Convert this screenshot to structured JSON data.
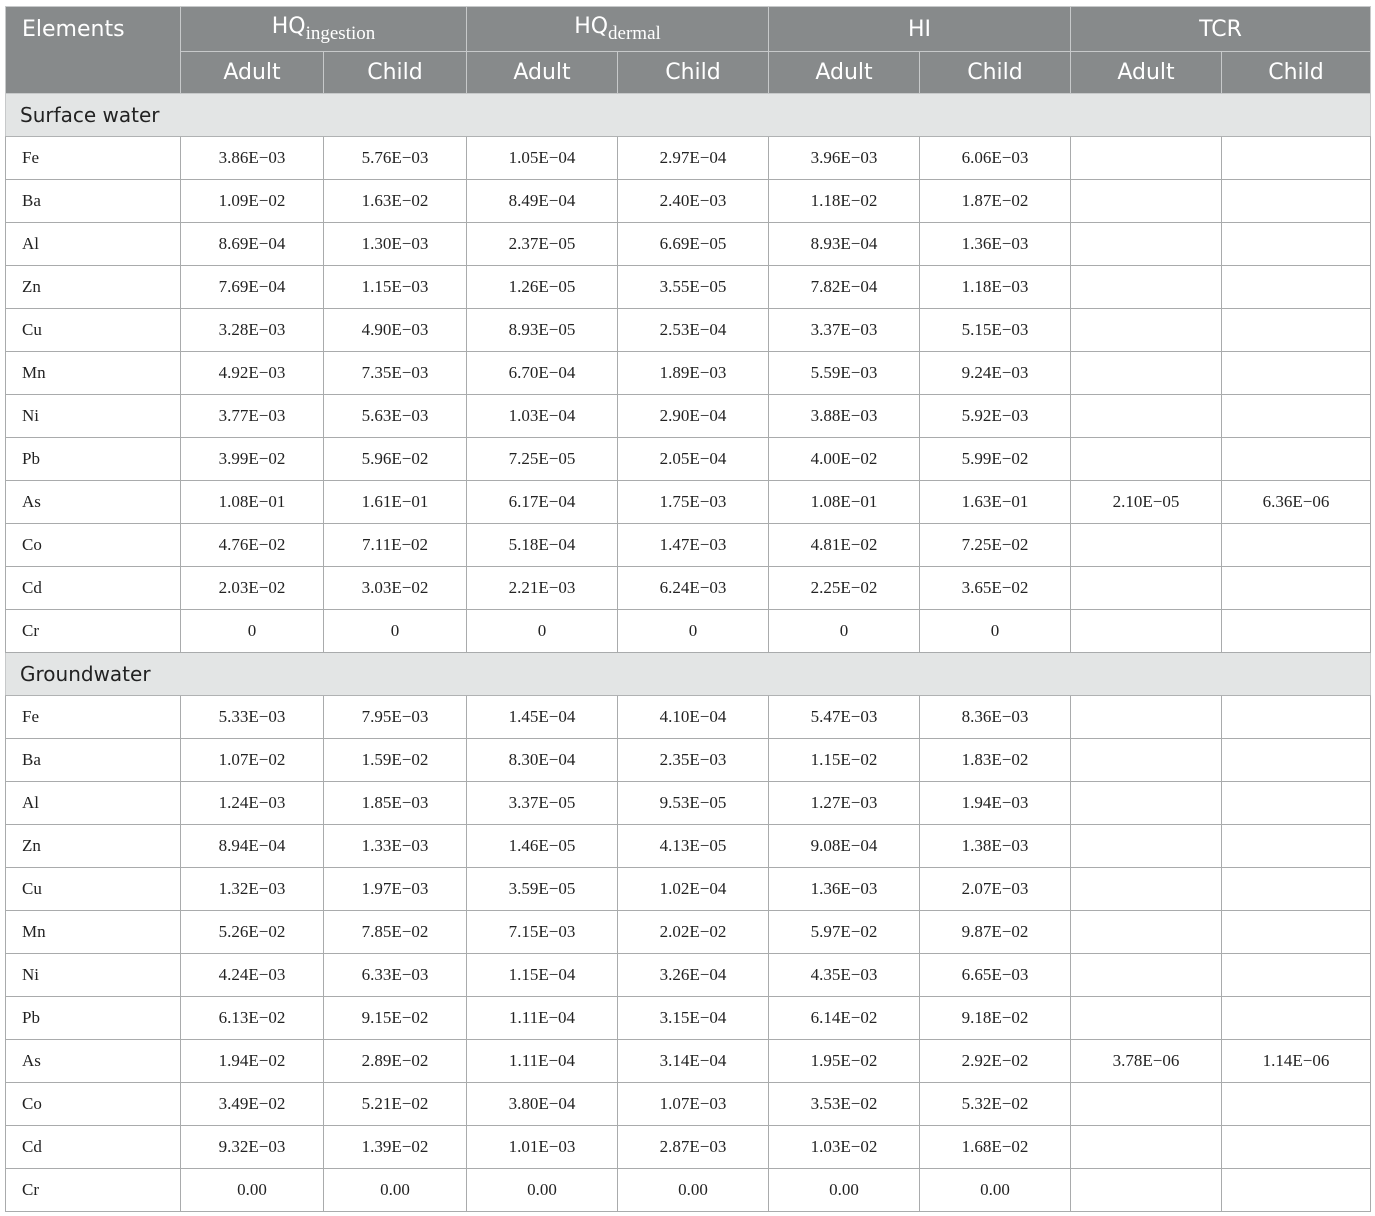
{
  "header": {
    "elements": "Elements",
    "groups": [
      {
        "main": "HQ",
        "sub": "ingestion"
      },
      {
        "main": "HQ",
        "sub": "dermal"
      },
      {
        "main": "HI",
        "sub": ""
      },
      {
        "main": "TCR",
        "sub": ""
      }
    ],
    "adult": "Adult",
    "child": "Child"
  },
  "sections": [
    {
      "title": "Surface water",
      "rows": [
        {
          "element": "Fe",
          "values": [
            "3.86E−03",
            "5.76E−03",
            "1.05E−04",
            "2.97E−04",
            "3.96E−03",
            "6.06E−03",
            "",
            ""
          ]
        },
        {
          "element": "Ba",
          "values": [
            "1.09E−02",
            "1.63E−02",
            "8.49E−04",
            "2.40E−03",
            "1.18E−02",
            "1.87E−02",
            "",
            ""
          ]
        },
        {
          "element": "Al",
          "values": [
            "8.69E−04",
            "1.30E−03",
            "2.37E−05",
            "6.69E−05",
            "8.93E−04",
            "1.36E−03",
            "",
            ""
          ]
        },
        {
          "element": "Zn",
          "values": [
            "7.69E−04",
            "1.15E−03",
            "1.26E−05",
            "3.55E−05",
            "7.82E−04",
            "1.18E−03",
            "",
            ""
          ]
        },
        {
          "element": "Cu",
          "values": [
            "3.28E−03",
            "4.90E−03",
            "8.93E−05",
            "2.53E−04",
            "3.37E−03",
            "5.15E−03",
            "",
            ""
          ]
        },
        {
          "element": "Mn",
          "values": [
            "4.92E−03",
            "7.35E−03",
            "6.70E−04",
            "1.89E−03",
            "5.59E−03",
            "9.24E−03",
            "",
            ""
          ]
        },
        {
          "element": "Ni",
          "values": [
            "3.77E−03",
            "5.63E−03",
            "1.03E−04",
            "2.90E−04",
            "3.88E−03",
            "5.92E−03",
            "",
            ""
          ]
        },
        {
          "element": "Pb",
          "values": [
            "3.99E−02",
            "5.96E−02",
            "7.25E−05",
            "2.05E−04",
            "4.00E−02",
            "5.99E−02",
            "",
            ""
          ]
        },
        {
          "element": "As",
          "values": [
            "1.08E−01",
            "1.61E−01",
            "6.17E−04",
            "1.75E−03",
            "1.08E−01",
            "1.63E−01",
            "2.10E−05",
            "6.36E−06"
          ]
        },
        {
          "element": "Co",
          "values": [
            "4.76E−02",
            "7.11E−02",
            "5.18E−04",
            "1.47E−03",
            "4.81E−02",
            "7.25E−02",
            "",
            ""
          ]
        },
        {
          "element": "Cd",
          "values": [
            "2.03E−02",
            "3.03E−02",
            "2.21E−03",
            "6.24E−03",
            "2.25E−02",
            "3.65E−02",
            "",
            ""
          ]
        },
        {
          "element": "Cr",
          "values": [
            "0",
            "0",
            "0",
            "0",
            "0",
            "0",
            "",
            ""
          ]
        }
      ]
    },
    {
      "title": "Groundwater",
      "rows": [
        {
          "element": "Fe",
          "values": [
            "5.33E−03",
            "7.95E−03",
            "1.45E−04",
            "4.10E−04",
            "5.47E−03",
            "8.36E−03",
            "",
            ""
          ]
        },
        {
          "element": "Ba",
          "values": [
            "1.07E−02",
            "1.59E−02",
            "8.30E−04",
            "2.35E−03",
            "1.15E−02",
            "1.83E−02",
            "",
            ""
          ]
        },
        {
          "element": "Al",
          "values": [
            "1.24E−03",
            "1.85E−03",
            "3.37E−05",
            "9.53E−05",
            "1.27E−03",
            "1.94E−03",
            "",
            ""
          ]
        },
        {
          "element": "Zn",
          "values": [
            "8.94E−04",
            "1.33E−03",
            "1.46E−05",
            "4.13E−05",
            "9.08E−04",
            "1.38E−03",
            "",
            ""
          ]
        },
        {
          "element": "Cu",
          "values": [
            "1.32E−03",
            "1.97E−03",
            "3.59E−05",
            "1.02E−04",
            "1.36E−03",
            "2.07E−03",
            "",
            ""
          ]
        },
        {
          "element": "Mn",
          "values": [
            "5.26E−02",
            "7.85E−02",
            "7.15E−03",
            "2.02E−02",
            "5.97E−02",
            "9.87E−02",
            "",
            ""
          ]
        },
        {
          "element": "Ni",
          "values": [
            "4.24E−03",
            "6.33E−03",
            "1.15E−04",
            "3.26E−04",
            "4.35E−03",
            "6.65E−03",
            "",
            ""
          ]
        },
        {
          "element": "Pb",
          "values": [
            "6.13E−02",
            "9.15E−02",
            "1.11E−04",
            "3.15E−04",
            "6.14E−02",
            "9.18E−02",
            "",
            ""
          ]
        },
        {
          "element": "As",
          "values": [
            "1.94E−02",
            "2.89E−02",
            "1.11E−04",
            "3.14E−04",
            "1.95E−02",
            "2.92E−02",
            "3.78E−06",
            "1.14E−06"
          ]
        },
        {
          "element": "Co",
          "values": [
            "3.49E−02",
            "5.21E−02",
            "3.80E−04",
            "1.07E−03",
            "3.53E−02",
            "5.32E−02",
            "",
            ""
          ]
        },
        {
          "element": "Cd",
          "values": [
            "9.32E−03",
            "1.39E−02",
            "1.01E−03",
            "2.87E−03",
            "1.03E−02",
            "1.68E−02",
            "",
            ""
          ]
        },
        {
          "element": "Cr",
          "values": [
            "0.00",
            "0.00",
            "0.00",
            "0.00",
            "0.00",
            "0.00",
            "",
            ""
          ]
        }
      ]
    }
  ]
}
